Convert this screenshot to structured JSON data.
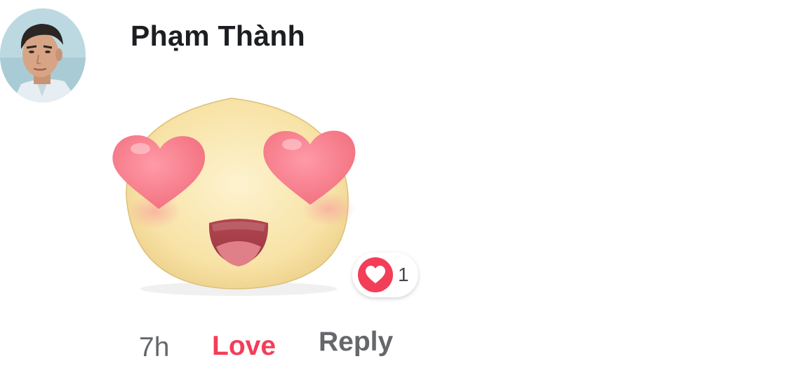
{
  "comment": {
    "author": "Phạm Thành",
    "avatar_icon": "user-avatar",
    "sticker_icon": "heart-eyes-face-sticker",
    "reaction": {
      "icon": "heart-icon",
      "color": "#f33e58",
      "count": "1"
    },
    "actions": {
      "time": "7h",
      "love_label": "Love",
      "reply_label": "Reply"
    }
  }
}
